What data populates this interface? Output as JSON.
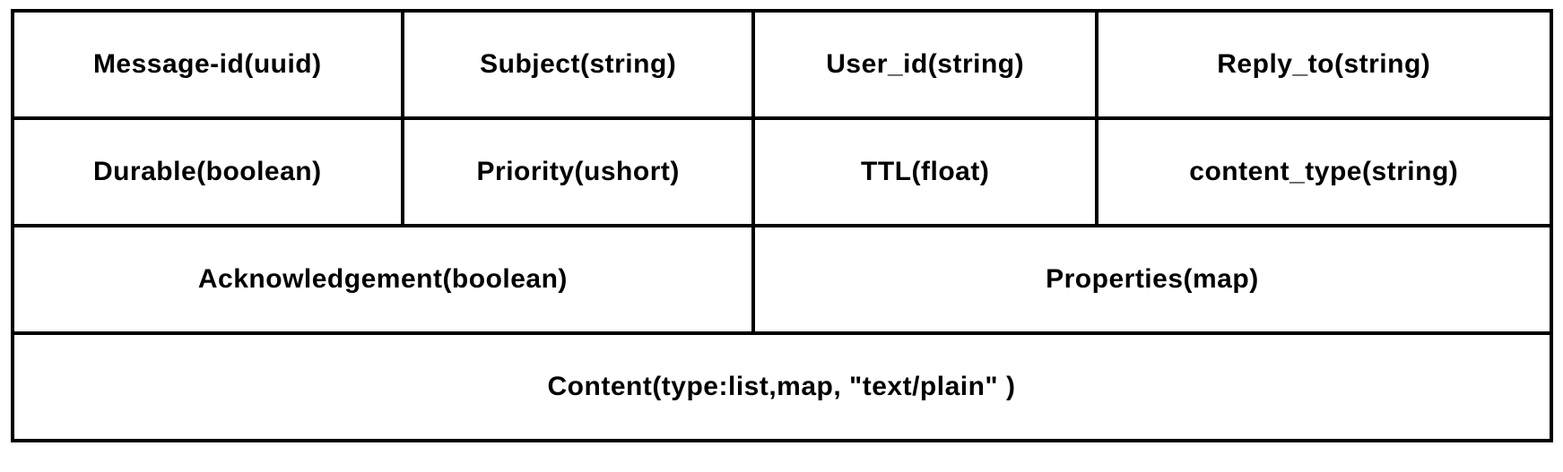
{
  "fields": {
    "message_id": "Message-id(uuid)",
    "subject": "Subject(string)",
    "user_id": "User_id(string)",
    "reply_to": "Reply_to(string)",
    "durable": "Durable(boolean)",
    "priority": "Priority(ushort)",
    "ttl": "TTL(float)",
    "content_type": "content_type(string)",
    "acknowledgement": "Acknowledgement(boolean)",
    "properties": "Properties(map)",
    "content": "Content(type:list,map, \"text/plain\" )"
  }
}
